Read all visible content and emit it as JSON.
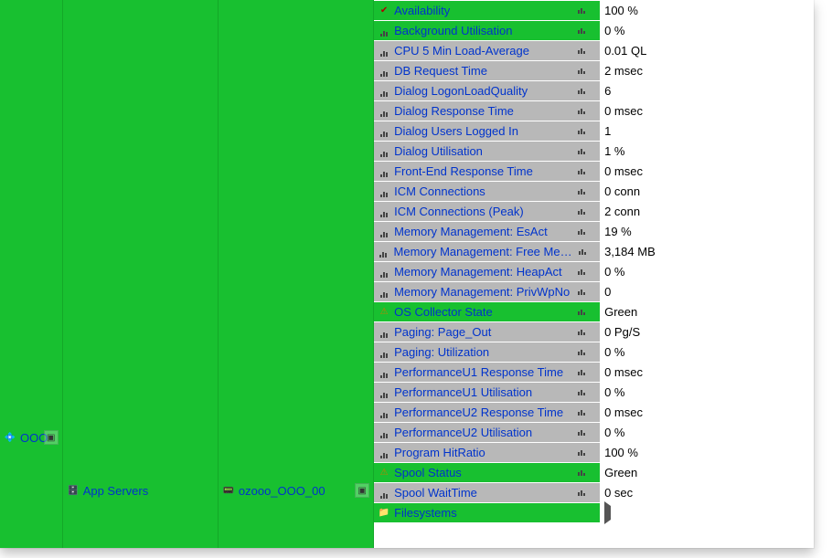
{
  "col1": {
    "label": "OOO"
  },
  "col2": {
    "label": "App Servers"
  },
  "col3": {
    "label": "ozooo_OOO_00"
  },
  "metrics": [
    {
      "name": "Availability",
      "value": "100 %",
      "bg": "green",
      "icon": "check"
    },
    {
      "name": "Background Utilisation",
      "value": "0 %",
      "bg": "green",
      "icon": "bars"
    },
    {
      "name": "CPU 5 Min Load-Average",
      "value": "0.01 QL",
      "bg": "grey",
      "icon": "bars"
    },
    {
      "name": "DB Request Time",
      "value": "2 msec",
      "bg": "grey",
      "icon": "bars"
    },
    {
      "name": "Dialog LogonLoadQuality",
      "value": "6",
      "bg": "grey",
      "icon": "bars"
    },
    {
      "name": "Dialog Response Time",
      "value": "0 msec",
      "bg": "grey",
      "icon": "bars"
    },
    {
      "name": "Dialog Users Logged In",
      "value": "1",
      "bg": "grey",
      "icon": "bars"
    },
    {
      "name": "Dialog Utilisation",
      "value": "1 %",
      "bg": "grey",
      "icon": "bars"
    },
    {
      "name": "Front-End Response Time",
      "value": "0 msec",
      "bg": "grey",
      "icon": "bars"
    },
    {
      "name": "ICM Connections",
      "value": "0 conn",
      "bg": "grey",
      "icon": "bars"
    },
    {
      "name": "ICM Connections (Peak)",
      "value": "2 conn",
      "bg": "grey",
      "icon": "bars"
    },
    {
      "name": "Memory Management: EsAct",
      "value": "19 %",
      "bg": "grey",
      "icon": "bars"
    },
    {
      "name": "Memory Management: Free Memory",
      "value": "3,184 MB",
      "bg": "grey",
      "icon": "bars"
    },
    {
      "name": "Memory Management: HeapAct",
      "value": "0 %",
      "bg": "grey",
      "icon": "bars"
    },
    {
      "name": "Memory Management: PrivWpNo",
      "value": "0",
      "bg": "grey",
      "icon": "bars"
    },
    {
      "name": "OS Collector State",
      "value": "Green",
      "bg": "green",
      "icon": "warn"
    },
    {
      "name": "Paging: Page_Out",
      "value": "0 Pg/S",
      "bg": "grey",
      "icon": "bars"
    },
    {
      "name": "Paging: Utilization",
      "value": "0 %",
      "bg": "grey",
      "icon": "bars"
    },
    {
      "name": "PerformanceU1 Response Time",
      "value": "0 msec",
      "bg": "grey",
      "icon": "bars"
    },
    {
      "name": "PerformanceU1 Utilisation",
      "value": "0 %",
      "bg": "grey",
      "icon": "bars"
    },
    {
      "name": "PerformanceU2 Response Time",
      "value": "0 msec",
      "bg": "grey",
      "icon": "bars"
    },
    {
      "name": "PerformanceU2 Utilisation",
      "value": "0 %",
      "bg": "grey",
      "icon": "bars"
    },
    {
      "name": "Program HitRatio",
      "value": "100 %",
      "bg": "grey",
      "icon": "bars"
    },
    {
      "name": "Spool Status",
      "value": "Green",
      "bg": "green",
      "icon": "warn"
    },
    {
      "name": "Spool WaitTime",
      "value": "0 sec",
      "bg": "grey",
      "icon": "bars"
    },
    {
      "name": "Filesystems",
      "value": "▶",
      "bg": "green",
      "icon": "folder",
      "isFolder": true
    }
  ]
}
